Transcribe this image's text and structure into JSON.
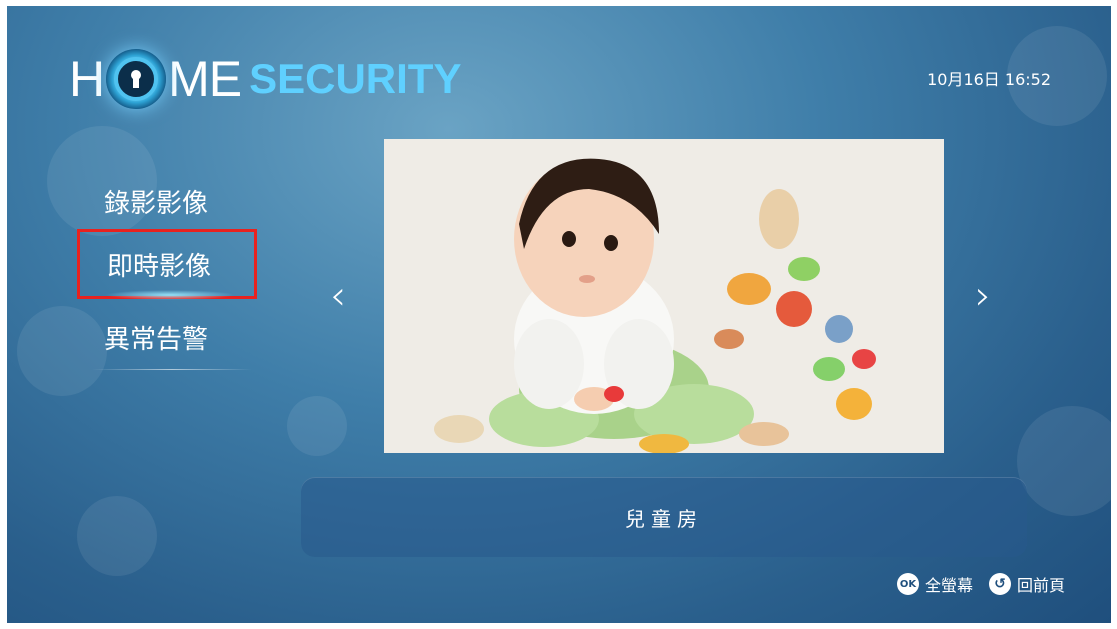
{
  "logo": {
    "text_h": "H",
    "text_me": "ME",
    "text_security": "SECURITY"
  },
  "datetime": "10月16日 16:52",
  "menu": {
    "items": [
      {
        "label": "錄影影像"
      },
      {
        "label": "即時影像",
        "selected": true
      },
      {
        "label": "異常告警"
      }
    ]
  },
  "camera": {
    "image": "child-playing-with-toy-food",
    "prev_icon": "‹",
    "next_icon": "›"
  },
  "room": {
    "name": "兒童房"
  },
  "hints": {
    "ok_icon": "OK",
    "ok_label": "全螢幕",
    "back_icon": "↺",
    "back_label": "回前頁"
  },
  "colors": {
    "accent": "#5fd0ff",
    "selection": "#e8221f"
  }
}
